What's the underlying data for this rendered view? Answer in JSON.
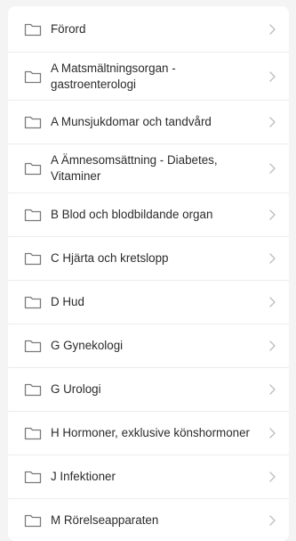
{
  "list": {
    "items": [
      {
        "label": "Förord"
      },
      {
        "label": "A Matsmältningsorgan - gastroenterologi"
      },
      {
        "label": "A Munsjukdomar och tandvård"
      },
      {
        "label": "A Ämnesomsättning - Diabetes, Vitaminer"
      },
      {
        "label": "B Blod och blodbildande organ"
      },
      {
        "label": "C Hjärta och kretslopp"
      },
      {
        "label": "D Hud"
      },
      {
        "label": "G Gynekologi"
      },
      {
        "label": "G Urologi"
      },
      {
        "label": "H Hormoner, exklusive könshormoner"
      },
      {
        "label": "J Infektioner"
      },
      {
        "label": "M Rörelseapparaten"
      }
    ]
  },
  "icons": {
    "item_icon": "folder-icon",
    "trailing_icon": "chevron-right-icon"
  },
  "colors": {
    "background": "#f4f4f5",
    "card": "#ffffff",
    "text": "#2b2b2b",
    "icon": "#7a7a7a",
    "chevron": "#c2c2c2",
    "divider": "#ececec"
  }
}
